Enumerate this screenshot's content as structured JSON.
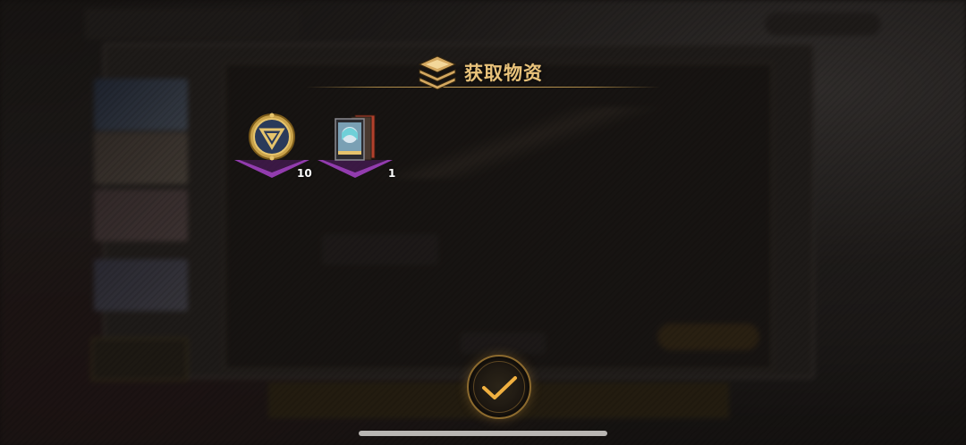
{
  "dialog": {
    "title": "获取物资",
    "icon": "stacked-supplies-icon",
    "accent_color": "#e8c27a"
  },
  "rewards": [
    {
      "name": "gold-emblem-medal",
      "icon": "gold-triangle-medal-icon",
      "count": "10"
    },
    {
      "name": "character-card-pack",
      "icon": "character-card-stack-icon",
      "count": "1"
    }
  ],
  "confirm": {
    "icon": "checkmark-icon",
    "color": "#e8a83a"
  }
}
